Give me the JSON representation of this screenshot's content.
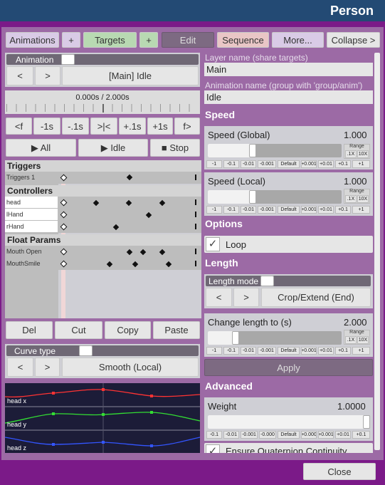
{
  "title": "Person",
  "tabs": {
    "animations": "Animations",
    "add1": "+",
    "targets": "Targets",
    "add2": "+",
    "edit": "Edit",
    "sequence": "Sequence",
    "more": "More...",
    "collapse": "Collapse >"
  },
  "left": {
    "animation_label": "Animation",
    "prev": "<",
    "next": ">",
    "animation_name": "[Main] Idle",
    "time_display": "0.000s / 2.000s",
    "step_buttons": [
      "<f",
      "-1s",
      "-.1s",
      ">|<",
      "+.1s",
      "+1s",
      "f>"
    ],
    "play_all": "▶ All",
    "play_idle": "▶ Idle",
    "stop": "■ Stop",
    "groups": {
      "triggers": "Triggers",
      "controllers": "Controllers",
      "float_params": "Float Params"
    },
    "rows": {
      "triggers1": "Triggers 1",
      "head": "head",
      "lhand": "lHand",
      "rhand": "rHand",
      "mouth_open": "Mouth Open",
      "mouth_smile": "MouthSmile"
    },
    "actions": [
      "Del",
      "Cut",
      "Copy",
      "Paste"
    ],
    "curve_type_label": "Curve type",
    "curve_prev": "<",
    "curve_next": ">",
    "curve_type": "Smooth (Local)",
    "curve_labels": [
      "head x",
      "head y",
      "head z"
    ]
  },
  "right": {
    "layer_name_label": "Layer name (share targets)",
    "layer_name": "Main",
    "anim_name_label": "Animation name (group with 'group/anim')",
    "anim_name": "Idle",
    "speed_header": "Speed",
    "speed_global_label": "Speed (Global)",
    "speed_global_value": "1.000",
    "speed_local_label": "Speed (Local)",
    "speed_local_value": "1.000",
    "range_label": "Range",
    "range_1x": ".1X",
    "range_10x": "10X",
    "step_buttons": [
      "-1",
      "-0.1",
      "-0.01",
      "-0.001",
      "Default",
      "+0.001",
      "+0.01",
      "+0.1",
      "+1"
    ],
    "options_header": "Options",
    "loop_label": "Loop",
    "check_mark": "✓",
    "length_header": "Length",
    "length_mode_label": "Length mode",
    "length_prev": "<",
    "length_next": ">",
    "length_mode": "Crop/Extend (End)",
    "change_length_label": "Change length to (s)",
    "change_length_value": "2.000",
    "apply": "Apply",
    "advanced_header": "Advanced",
    "weight_label": "Weight",
    "weight_value": "1.0000",
    "weight_steps": [
      "-0.1",
      "-0.01",
      "-0.001",
      "-0.000",
      "Default",
      "+0.000",
      "+0.001",
      "+0.01",
      "+0.1"
    ],
    "quaternion_label": "Ensure Quaternion Continuity"
  },
  "close": "Close",
  "colors": {
    "background": "#7b1a88",
    "title_bar": "#234a74",
    "tab_green": "#b8d9b2",
    "tab_pink": "#e9c6c6",
    "tab_lavender": "#d9cbe6",
    "curve_red": "#ff3333",
    "curve_green": "#33dd33",
    "curve_blue": "#3355ff"
  },
  "chart_data": {
    "type": "line",
    "series": [
      {
        "name": "head x",
        "keyframes": 4
      },
      {
        "name": "head y",
        "keyframes": 4
      },
      {
        "name": "head z",
        "keyframes": 4
      }
    ]
  }
}
